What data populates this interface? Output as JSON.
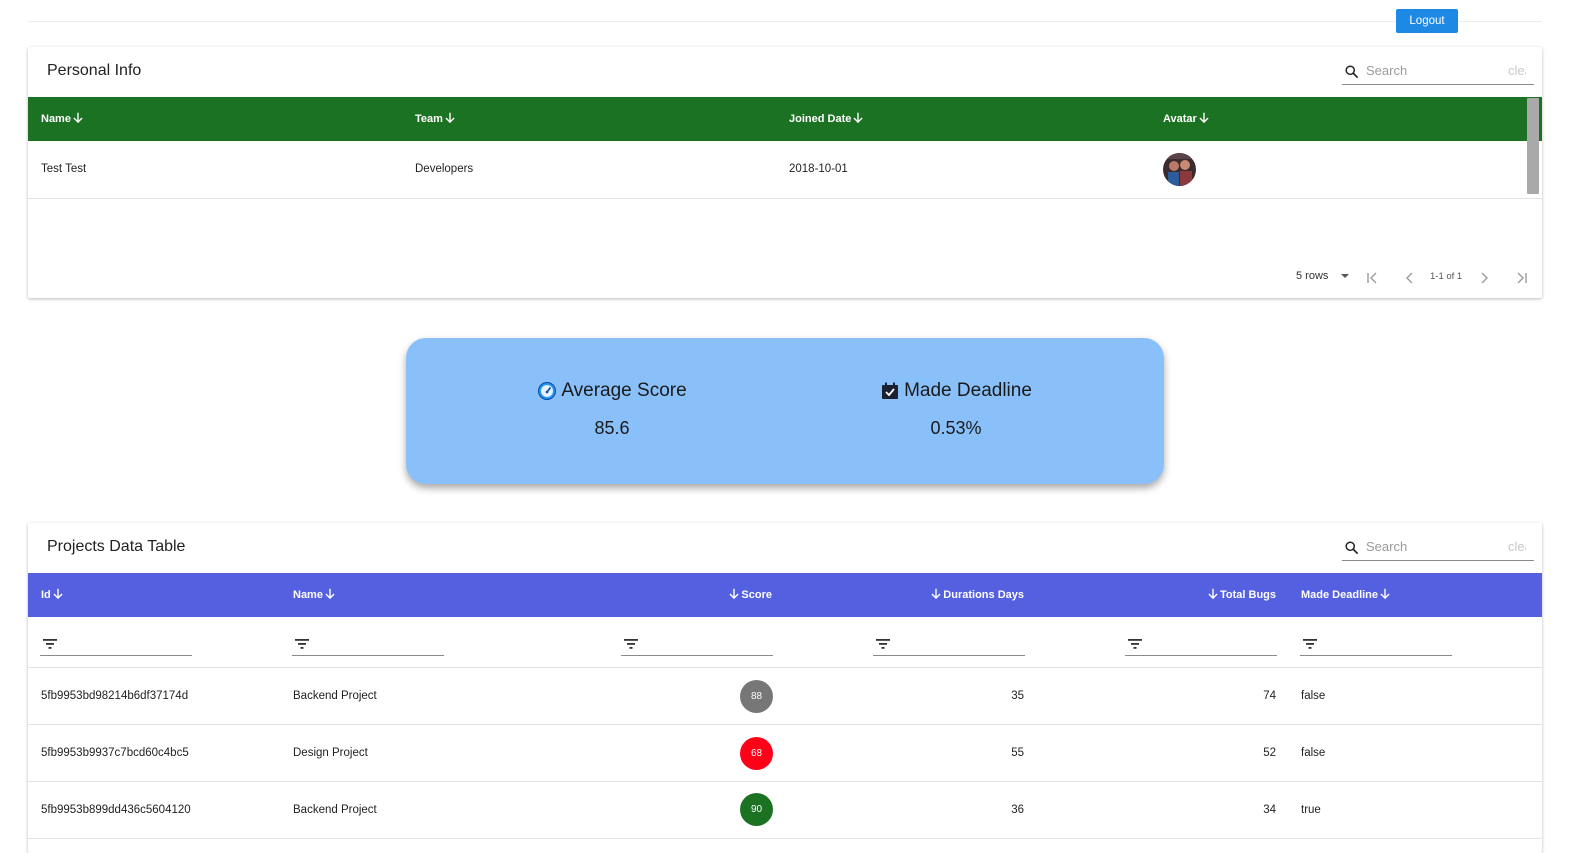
{
  "header": {
    "logout_label": "Logout"
  },
  "personal_info": {
    "title": "Personal Info",
    "search_placeholder": "Search",
    "clear_label": "clear",
    "columns": [
      "Name",
      "Team",
      "Joined Date",
      "Avatar"
    ],
    "header_color": "#1b7222",
    "rows": [
      {
        "name": "Test Test",
        "team": "Developers",
        "joined": "2018-10-01",
        "avatar": "avatar-image"
      }
    ],
    "pagination": {
      "rows_label": "5 rows",
      "range": "1-1 of 1"
    }
  },
  "stats": {
    "average_score": {
      "label": "Average Score",
      "value": "85.6",
      "icon": "speedometer-icon"
    },
    "made_deadline": {
      "label": "Made Deadline",
      "value": "0.53%",
      "icon": "calendar-check-icon"
    },
    "background": "#8ac0fa"
  },
  "projects": {
    "title": "Projects Data Table",
    "search_placeholder": "Search",
    "clear_label": "clear",
    "header_color": "#5460e0",
    "columns": [
      "Id",
      "Name",
      "Score",
      "Durations Days",
      "Total Bugs",
      "Made Deadline"
    ],
    "rows": [
      {
        "id": "5fb9953bd98214b6df37174d",
        "name": "Backend Project",
        "score": "88",
        "score_color": "#777777",
        "duration": "35",
        "bugs": "74",
        "deadline": "false"
      },
      {
        "id": "5fb9953b9937c7bcd60c4bc5",
        "name": "Design Project",
        "score": "68",
        "score_color": "#ff0018",
        "duration": "55",
        "bugs": "52",
        "deadline": "false"
      },
      {
        "id": "5fb9953b899dd436c5604120",
        "name": "Backend Project",
        "score": "90",
        "score_color": "#1b7222",
        "duration": "36",
        "bugs": "34",
        "deadline": "true"
      }
    ]
  }
}
